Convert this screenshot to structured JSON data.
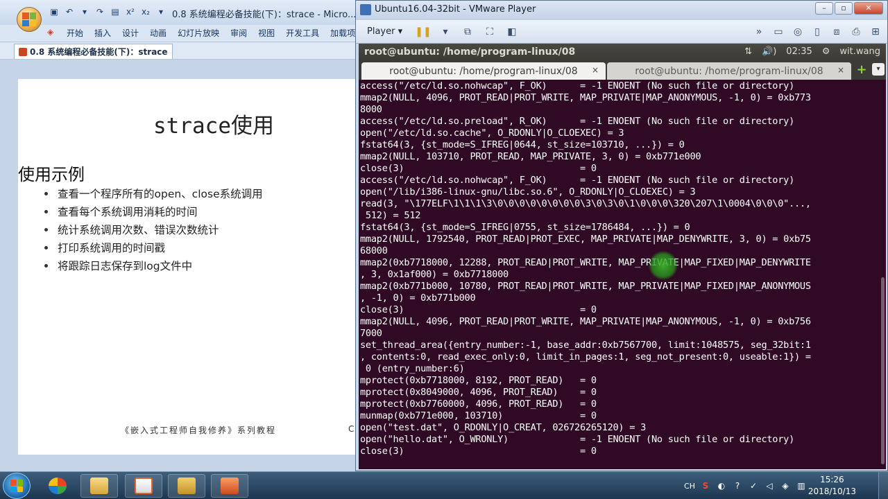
{
  "ppt": {
    "title": "0.8 系统编程必备技能(下)：strace - Micro...",
    "ribbon_tabs": [
      "开始",
      "插入",
      "设计",
      "动画",
      "幻灯片放映",
      "审阅",
      "视图",
      "开发工具",
      "加载项"
    ],
    "doc_tab": "0.8 系统编程必备技能(下)：strace",
    "slide": {
      "title": "strace使用",
      "heading": "使用示例",
      "bullets": [
        "查看一个程序所有的open、close系统调用",
        "查看每个系统调用消耗的时间",
        "统计系统调用次数、错误次数统计",
        "打印系统调用的时间戳",
        "将跟踪日志保存到log文件中"
      ],
      "footer": "《嵌入式工程师自我修养》系列教程",
      "footer_right": "C"
    }
  },
  "vmware": {
    "title": "Ubuntu16.04-32bit - VMware Player",
    "player_menu": "Player ▾",
    "window_buttons": [
      "–",
      "▫",
      "✕"
    ]
  },
  "ubuntu": {
    "panel_title": "root@ubuntu: /home/program-linux/08",
    "indicators": {
      "network": "⇅",
      "volume": "🔊)",
      "time": "02:35",
      "settings": "⚙",
      "user": "wit.wang"
    },
    "tabs": [
      {
        "label": "root@ubuntu: /home/program-linux/08",
        "active": true
      },
      {
        "label": "root@ubuntu: /home/program-linux/08",
        "active": false
      }
    ],
    "new_tab": "+",
    "tab_menu": "▾"
  },
  "terminal": {
    "lines": [
      "access(\"/etc/ld.so.nohwcap\", F_OK)      = -1 ENOENT (No such file or directory)",
      "mmap2(NULL, 4096, PROT_READ|PROT_WRITE, MAP_PRIVATE|MAP_ANONYMOUS, -1, 0) = 0xb773",
      "8000",
      "access(\"/etc/ld.so.preload\", R_OK)      = -1 ENOENT (No such file or directory)",
      "open(\"/etc/ld.so.cache\", O_RDONLY|O_CLOEXEC) = 3",
      "fstat64(3, {st_mode=S_IFREG|0644, st_size=103710, ...}) = 0",
      "mmap2(NULL, 103710, PROT_READ, MAP_PRIVATE, 3, 0) = 0xb771e000",
      "close(3)                                = 0",
      "access(\"/etc/ld.so.nohwcap\", F_OK)      = -1 ENOENT (No such file or directory)",
      "open(\"/lib/i386-linux-gnu/libc.so.6\", O_RDONLY|O_CLOEXEC) = 3",
      "read(3, \"\\177ELF\\1\\1\\1\\3\\0\\0\\0\\0\\0\\0\\0\\0\\3\\0\\3\\0\\1\\0\\0\\0\\320\\207\\1\\0004\\0\\0\\0\"...,",
      " 512) = 512",
      "fstat64(3, {st_mode=S_IFREG|0755, st_size=1786484, ...}) = 0",
      "mmap2(NULL, 1792540, PROT_READ|PROT_EXEC, MAP_PRIVATE|MAP_DENYWRITE, 3, 0) = 0xb75",
      "68000",
      "mmap2(0xb7718000, 12288, PROT_READ|PROT_WRITE, MAP_PRIVATE|MAP_FIXED|MAP_DENYWRITE",
      ", 3, 0x1af000) = 0xb7718000",
      "mmap2(0xb771b000, 10780, PROT_READ|PROT_WRITE, MAP_PRIVATE|MAP_FIXED|MAP_ANONYMOUS",
      ", -1, 0) = 0xb771b000",
      "close(3)                                = 0",
      "mmap2(NULL, 4096, PROT_READ|PROT_WRITE, MAP_PRIVATE|MAP_ANONYMOUS, -1, 0) = 0xb756",
      "7000",
      "set_thread_area({entry_number:-1, base_addr:0xb7567700, limit:1048575, seg_32bit:1",
      ", contents:0, read_exec_only:0, limit_in_pages:1, seg_not_present:0, useable:1}) =",
      " 0 (entry_number:6)",
      "mprotect(0xb7718000, 8192, PROT_READ)   = 0",
      "mprotect(0x8049000, 4096, PROT_READ)    = 0",
      "mprotect(0xb7760000, 4096, PROT_READ)   = 0",
      "munmap(0xb771e000, 103710)              = 0",
      "open(\"test.dat\", O_RDONLY|O_CREAT, 026726265120) = 3",
      "open(\"hello.dat\", O_WRONLY)             = -1 ENOENT (No such file or directory)",
      "close(3)                                = 0"
    ]
  },
  "taskbar": {
    "tray_lang": "CH",
    "time": "15:26",
    "date": "2018/10/13"
  },
  "colors": {
    "terminal_bg": "#300a24",
    "terminal_fg": "#ffffff",
    "ubuntu_panel": "#3c3b37",
    "cursor_highlight": "#2f9a1e"
  }
}
